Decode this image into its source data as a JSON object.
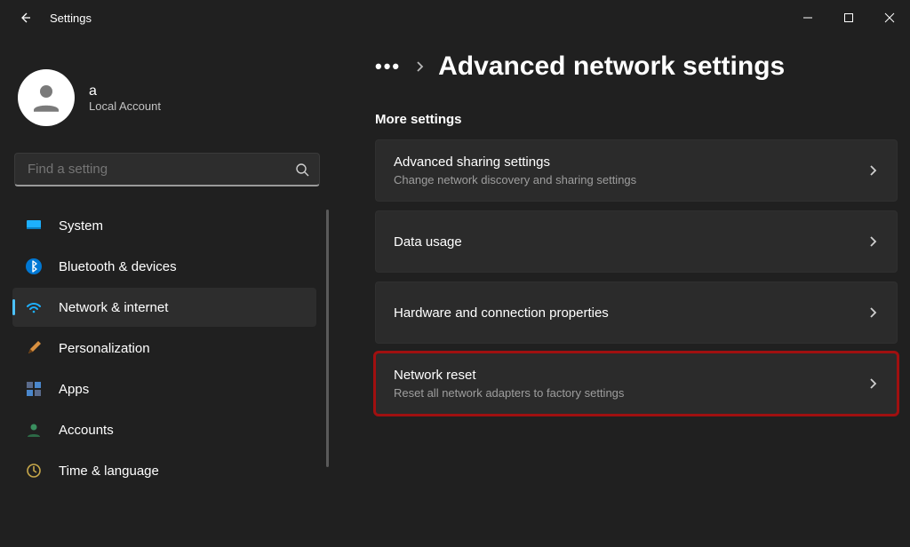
{
  "app_title": "Settings",
  "profile": {
    "name": "a",
    "subtitle": "Local Account"
  },
  "search": {
    "placeholder": "Find a setting"
  },
  "sidebar": {
    "items": [
      {
        "label": "System"
      },
      {
        "label": "Bluetooth & devices"
      },
      {
        "label": "Network & internet"
      },
      {
        "label": "Personalization"
      },
      {
        "label": "Apps"
      },
      {
        "label": "Accounts"
      },
      {
        "label": "Time & language"
      }
    ],
    "selected_index": 2
  },
  "breadcrumb": {
    "title": "Advanced network settings"
  },
  "section_header": "More settings",
  "cards": [
    {
      "title": "Advanced sharing settings",
      "subtitle": "Change network discovery and sharing settings"
    },
    {
      "title": "Data usage",
      "subtitle": ""
    },
    {
      "title": "Hardware and connection properties",
      "subtitle": ""
    },
    {
      "title": "Network reset",
      "subtitle": "Reset all network adapters to factory settings"
    }
  ],
  "highlight_card_index": 3
}
